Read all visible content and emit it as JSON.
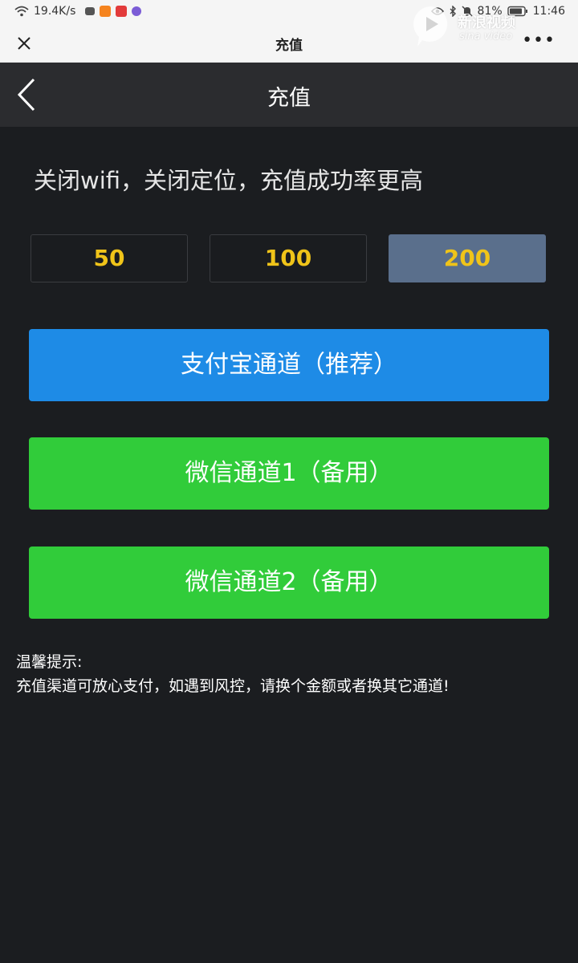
{
  "status_bar": {
    "network_speed": "19.4K/s",
    "battery": "81%",
    "time": "11:46"
  },
  "browser": {
    "title": "充值",
    "more": "•••",
    "watermark_text": "新浪视频",
    "watermark_sub": "sina video"
  },
  "header": {
    "title": "充值"
  },
  "tip": "关闭wifi，关闭定位，充值成功率更高",
  "amounts": [
    "50",
    "100",
    "200"
  ],
  "selected_amount_index": 2,
  "buttons": {
    "alipay": "支付宝通道（推荐）",
    "wechat1": "微信通道1（备用）",
    "wechat2": "微信通道2（备用）"
  },
  "notice": {
    "title": "温馨提示:",
    "text": "充值渠道可放心支付，如遇到风控，请换个金额或者换其它通道!"
  },
  "colors": {
    "background": "#1b1d20",
    "header": "#2b2c2f",
    "amount_text": "#f0c419",
    "amount_selected": "#5a6f8c",
    "alipay": "#1e8be6",
    "wechat": "#31cc3a"
  }
}
